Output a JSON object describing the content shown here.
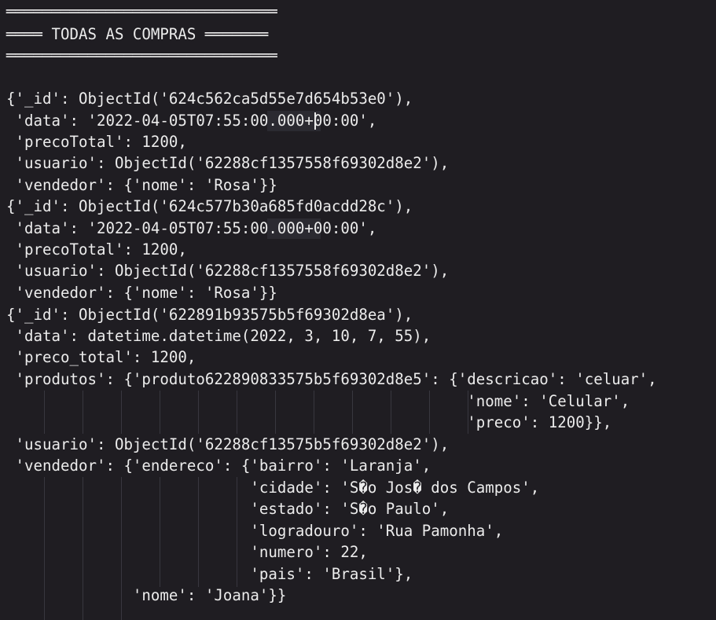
{
  "terminal": {
    "lines": [
      "══════════════════════════════",
      "════ TODAS AS COMPRAS ═══════",
      "══════════════════════════════",
      "",
      "{'_id': ObjectId('624c562ca5d55e7d654b53e0'),",
      " 'data': '2022-04-05T07:55:00.000+00:00',",
      " 'precoTotal': 1200,",
      " 'usuario': ObjectId('62288cf1357558f69302d8e2'),",
      " 'vendedor': {'nome': 'Rosa'}}",
      "{'_id': ObjectId('624c577b30a685fd0acdd28c'),",
      " 'data': '2022-04-05T07:55:00.000+00:00',",
      " 'precoTotal': 1200,",
      " 'usuario': ObjectId('62288cf1357558f69302d8e2'),",
      " 'vendedor': {'nome': 'Rosa'}}",
      "{'_id': ObjectId('622891b93575b5f69302d8ea'),",
      " 'data': datetime.datetime(2022, 3, 10, 7, 55),",
      " 'preco_total': 1200,",
      " 'produtos': {'produto622890833575b5f69302d8e5': {'descricao': 'celuar',",
      "                                                   'nome': 'Celular',",
      "                                                   'preco': 1200}},",
      " 'usuario': ObjectId('62288cf13575b5f69302d8e2'),",
      " 'vendedor': {'endereco': {'bairro': 'Laranja',",
      "                           'cidade': 'S�o Jos� dos Campos',",
      "                           'estado': 'S�o Paulo',",
      "                           'logradouro': 'Rua Pamonha',",
      "                           'numero': 22,",
      "                           'pais': 'Brasil'},",
      "              'nome': 'Joana'}}"
    ]
  },
  "colors": {
    "background": "#1f1d22",
    "text": "#ececec",
    "indent_guide": "#38373f",
    "selection_highlight": "#2b2a31",
    "cursor": "#e8e8e8"
  }
}
